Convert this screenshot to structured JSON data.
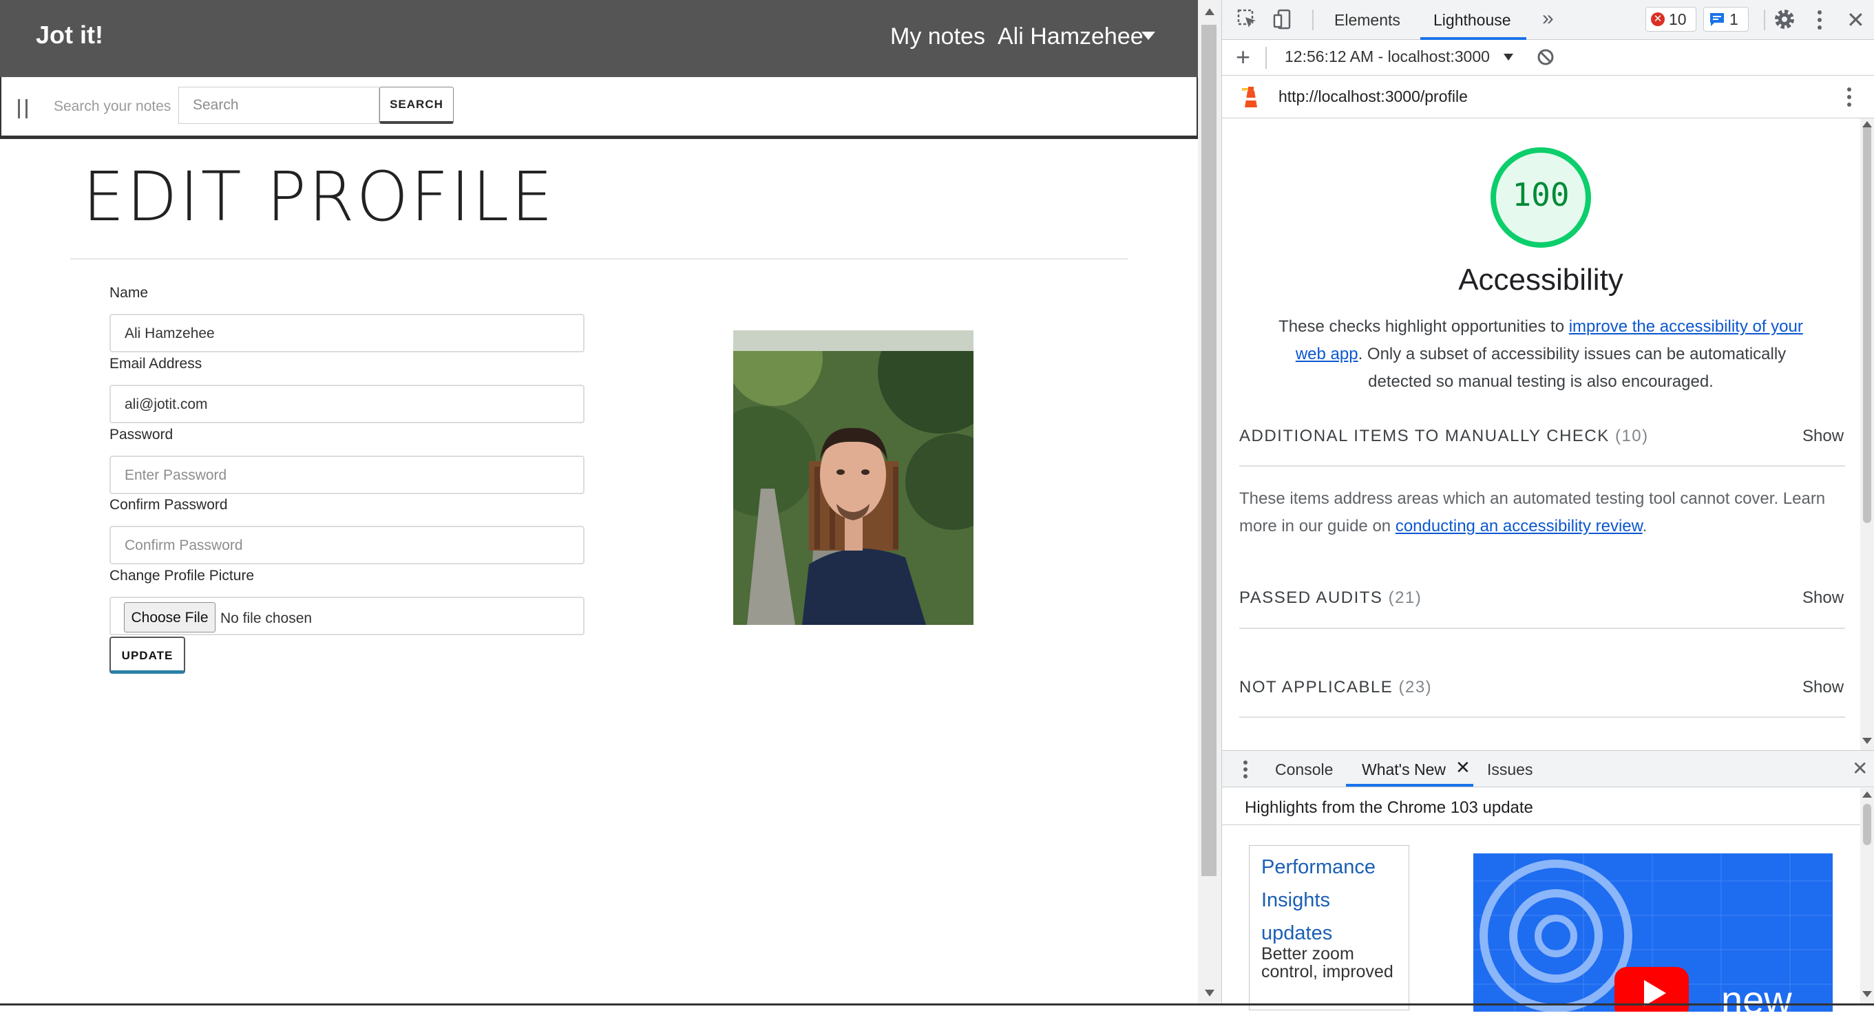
{
  "app": {
    "brand": "Jot it!",
    "nav": {
      "my_notes": "My notes",
      "user_name": "Ali Hamzehee"
    },
    "search": {
      "label": "Search your notes",
      "placeholder": "Search",
      "button": "SEARCH"
    },
    "page_title": "EDIT PROFILE",
    "form": {
      "name_label": "Name",
      "name_value": "Ali Hamzehee",
      "email_label": "Email Address",
      "email_value": "ali@jotit.com",
      "password_label": "Password",
      "password_placeholder": "Enter Password",
      "confirm_label": "Confirm Password",
      "confirm_placeholder": "Confirm Password",
      "picture_label": "Change Profile Picture",
      "choose_file": "Choose File",
      "no_file": "No file chosen",
      "update_button": "UPDATE"
    }
  },
  "devtools": {
    "tabs": {
      "elements": "Elements",
      "lighthouse": "Lighthouse",
      "more": "»"
    },
    "errors_count": "10",
    "messages_count": "1",
    "report_selector": "12:56:12 AM - localhost:3000",
    "url": "http://localhost:3000/profile",
    "score": "100",
    "category_title": "Accessibility",
    "desc_1": "These checks highlight opportunities to ",
    "desc_link": "improve the accessibility of your web app",
    "desc_2": ". Only a subset of accessibility issues can be automatically detected so manual testing is also encouraged.",
    "groups": {
      "manual": {
        "title": "ADDITIONAL ITEMS TO MANUALLY CHECK",
        "count": "(10)",
        "show": "Show"
      },
      "passed": {
        "title": "PASSED AUDITS",
        "count": "(21)",
        "show": "Show"
      },
      "na": {
        "title": "NOT APPLICABLE",
        "count": "(23)",
        "show": "Show"
      }
    },
    "manual_desc_1": "These items address areas which an automated testing tool cannot cover. Learn more in our guide on ",
    "manual_desc_link": "conducting an accessibility review",
    "manual_desc_2": ".",
    "drawer": {
      "tabs": {
        "console": "Console",
        "whats_new": "What's New",
        "issues": "Issues"
      },
      "header": "Highlights from the Chrome 103 update",
      "card_title": "Performance Insights updates",
      "card_text": "Better zoom control, improved",
      "video_text": "new"
    },
    "colors": {
      "score_green": "#0cce6b",
      "accent_blue": "#1a73e8",
      "link_blue": "#0b57d0"
    }
  }
}
